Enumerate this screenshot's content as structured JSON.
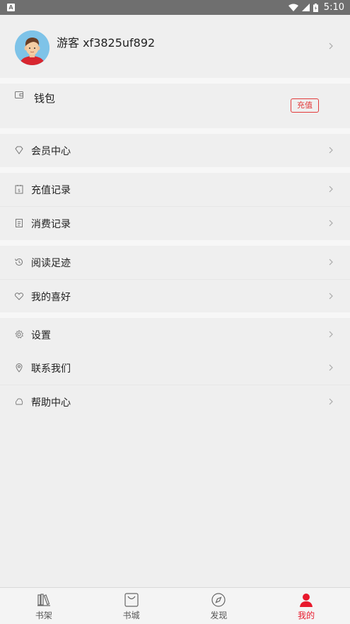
{
  "status_bar": {
    "app_badge": "A",
    "time": "5:10"
  },
  "profile": {
    "name": "游客 xf3825uf892"
  },
  "wallet": {
    "label": "钱包",
    "recharge_button": "充值"
  },
  "menu": {
    "vip_center": "会员中心",
    "recharge_records": "充值记录",
    "consume_records": "消费记录",
    "reading_history": "阅读足迹",
    "my_favorites": "我的喜好",
    "settings": "设置",
    "contact_us": "联系我们",
    "help_center": "帮助中心"
  },
  "tabbar": {
    "items": [
      {
        "label": "书架"
      },
      {
        "label": "书城"
      },
      {
        "label": "发现"
      },
      {
        "label": "我的"
      }
    ],
    "active_color": "#e8192c"
  }
}
